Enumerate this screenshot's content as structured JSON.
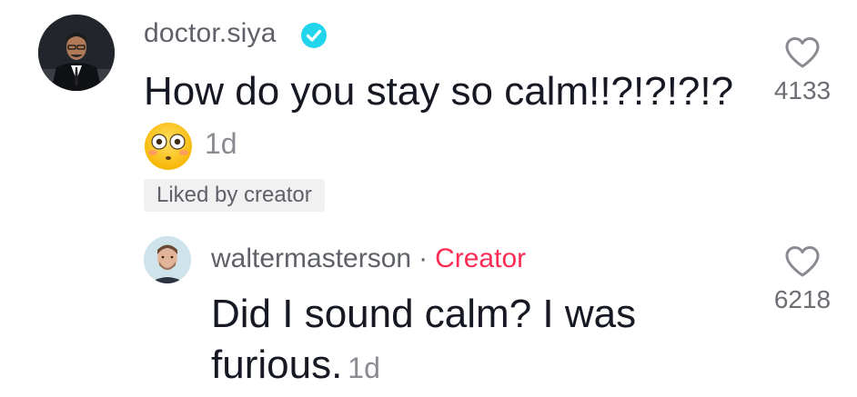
{
  "comment": {
    "username": "doctor.siya",
    "verified_icon": "verified-badge-icon",
    "text": "How do you stay so calm!!?!?!?!?",
    "emoji": "flushed-face-emoji",
    "time": "1d",
    "liked_badge": "Liked by creator",
    "like_count": "4133"
  },
  "reply": {
    "username": "waltermasterson",
    "separator": "·",
    "creator_label": "Creator",
    "text": "Did I sound calm? I was furious.",
    "time": "1d",
    "like_count": "6218"
  },
  "colors": {
    "verified_blue": "#20d5ec",
    "creator_red": "#fe2c55",
    "secondary_text": "#5f6168",
    "meta_text": "#8a8b91"
  }
}
